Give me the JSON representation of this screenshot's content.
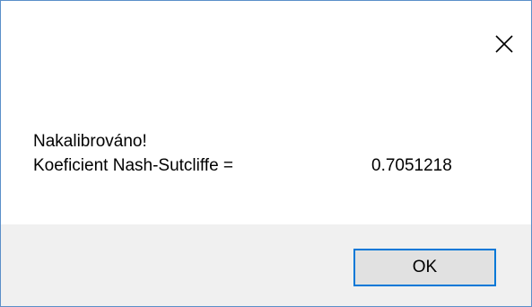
{
  "titlebar": {
    "close_icon": "close-icon"
  },
  "message": {
    "line1": "Nakalibrováno!",
    "label": "Koeficient Nash-Sutcliffe =",
    "value": "0.7051218"
  },
  "buttons": {
    "ok_label": "OK"
  },
  "colors": {
    "border": "#5b8fc9",
    "footer_bg": "#f0f0f0",
    "button_bg": "#e1e1e1",
    "button_focus_border": "#0078d7"
  }
}
